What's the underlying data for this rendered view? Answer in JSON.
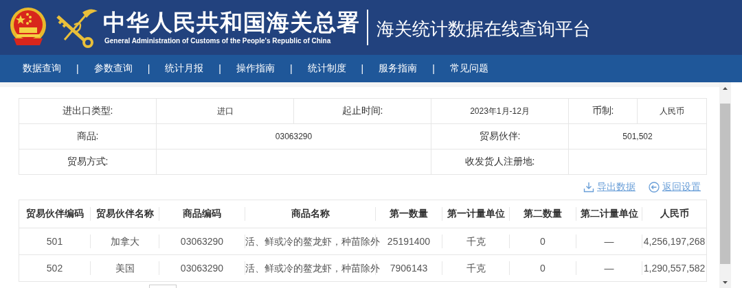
{
  "header": {
    "title_cn": "中华人民共和国海关总署",
    "title_en": "General Administration of Customs of the People's Republic of China",
    "platform_title": "海关统计数据在线查询平台"
  },
  "nav": {
    "items": [
      "数据查询",
      "参数查询",
      "统计月报",
      "操作指南",
      "统计制度",
      "服务指南",
      "常见问题"
    ],
    "separator": "|"
  },
  "query": {
    "rows": [
      [
        {
          "kind": "label",
          "text": "进出口类型:"
        },
        {
          "kind": "value",
          "text": "进口"
        },
        {
          "kind": "label",
          "text": "起止时间:"
        },
        {
          "kind": "value",
          "text": "2023年1月-12月"
        },
        {
          "kind": "label",
          "text": "币制:"
        },
        {
          "kind": "value",
          "text": "人民币"
        }
      ],
      [
        {
          "kind": "label",
          "text": "商品:"
        },
        {
          "kind": "wide",
          "text": "03063290"
        },
        {
          "kind": "merged"
        },
        {
          "kind": "label",
          "text": "贸易伙伴:"
        },
        {
          "kind": "wide",
          "text": "501,502"
        },
        {
          "kind": "merged"
        }
      ],
      [
        {
          "kind": "label",
          "text": "贸易方式:"
        },
        {
          "kind": "wide"
        },
        {
          "kind": "merged"
        },
        {
          "kind": "label",
          "text": "收发货人注册地:"
        },
        {
          "kind": "wide"
        },
        {
          "kind": "merged"
        }
      ]
    ]
  },
  "actions": [
    {
      "kind": "export",
      "label": "导出数据"
    },
    {
      "kind": "back",
      "label": "返回设置"
    }
  ],
  "results": {
    "columns": [
      "贸易伙伴编码",
      "贸易伙伴名称",
      "商品编码",
      "商品名称",
      "第一数量",
      "第一计量单位",
      "第二数量",
      "第二计量单位",
      "人民币"
    ],
    "rows": [
      [
        "501",
        "加拿大",
        "03063290",
        "活、鲜或冷的鳌龙虾，种苗除外",
        "25191400",
        "千克",
        "0",
        "—",
        "4,256,197,268"
      ],
      [
        "502",
        "美国",
        "03063290",
        "活、鲜或冷的鳌龙虾，种苗除外",
        "7906143",
        "千克",
        "0",
        "—",
        "1,290,557,582"
      ]
    ]
  }
}
